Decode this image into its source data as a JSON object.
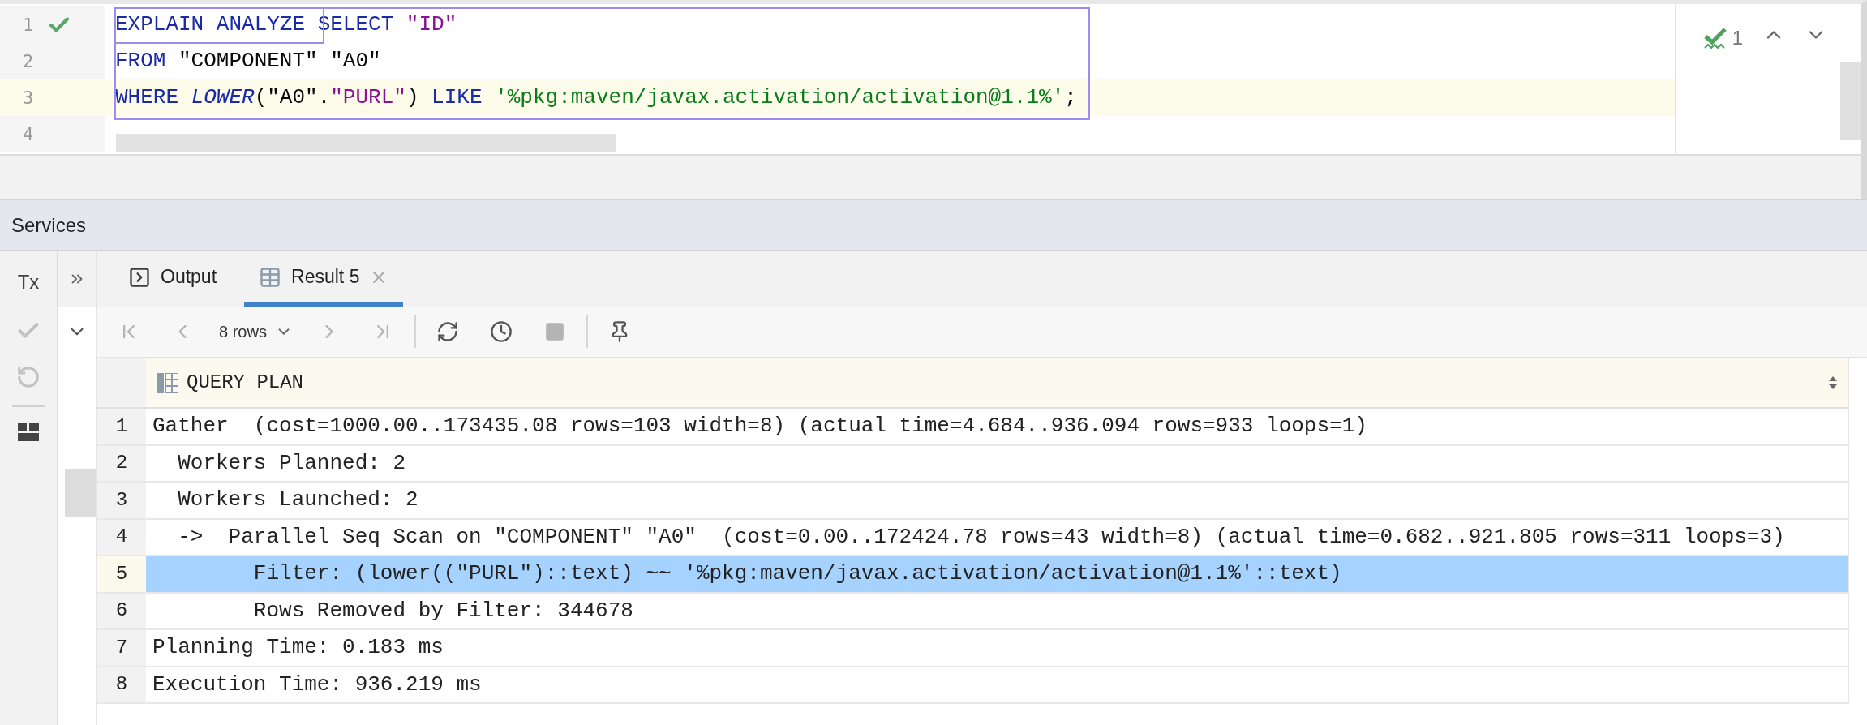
{
  "editor": {
    "lines": [
      {
        "number": "1",
        "executed": true,
        "current": false,
        "tokens": [
          {
            "kind": "keyword",
            "text": "EXPLAIN ANALYZE "
          },
          {
            "kind": "keyword",
            "text": "SELECT "
          },
          {
            "kind": "identifier",
            "text": "\"ID\""
          }
        ]
      },
      {
        "number": "2",
        "executed": false,
        "current": false,
        "tokens": [
          {
            "kind": "keyword",
            "text": "FROM "
          },
          {
            "kind": "plain",
            "text": "\"COMPONENT\" \"A0\""
          }
        ]
      },
      {
        "number": "3",
        "executed": false,
        "current": true,
        "tokens": [
          {
            "kind": "keyword",
            "text": "WHERE "
          },
          {
            "kind": "function",
            "text": "LOWER"
          },
          {
            "kind": "plain",
            "text": "(\"A0\"."
          },
          {
            "kind": "identifier",
            "text": "\"PURL\""
          },
          {
            "kind": "plain",
            "text": ") "
          },
          {
            "kind": "keyword",
            "text": "LIKE "
          },
          {
            "kind": "string",
            "text": "'%pkg:maven/javax.activation/activation@1.1%'"
          },
          {
            "kind": "plain",
            "text": ";"
          }
        ]
      },
      {
        "number": "4",
        "executed": false,
        "current": false
      }
    ],
    "inspections": {
      "count": "1"
    }
  },
  "services": {
    "title": "Services",
    "side_actions": [
      {
        "kind": "tx",
        "label": "Tx",
        "disabled": false
      },
      {
        "kind": "commit",
        "disabled": true
      },
      {
        "kind": "rollback",
        "disabled": true
      },
      {
        "kind": "layout",
        "disabled": false
      }
    ],
    "tabs": [
      {
        "kind": "console",
        "label": "Output",
        "selected": false,
        "closable": false
      },
      {
        "kind": "table",
        "label": "Result 5",
        "selected": true,
        "closable": true
      }
    ],
    "toolbar": [
      {
        "kind": "first",
        "disabled": true
      },
      {
        "kind": "prev",
        "disabled": true
      },
      {
        "kind": "page_size",
        "label": "8 rows"
      },
      {
        "kind": "next",
        "disabled": true
      },
      {
        "kind": "last",
        "disabled": true
      },
      {
        "kind": "separator"
      },
      {
        "kind": "reload",
        "disabled": false
      },
      {
        "kind": "history",
        "disabled": false
      },
      {
        "kind": "stop",
        "disabled": true
      },
      {
        "kind": "separator"
      },
      {
        "kind": "pin",
        "disabled": false
      }
    ],
    "table": {
      "column": "QUERY PLAN",
      "rows": [
        {
          "number": "1",
          "text": "Gather  (cost=1000.00..173435.08 rows=103 width=8) (actual time=4.684..936.094 rows=933 loops=1)",
          "selected": false
        },
        {
          "number": "2",
          "text": "  Workers Planned: 2",
          "selected": false
        },
        {
          "number": "3",
          "text": "  Workers Launched: 2",
          "selected": false
        },
        {
          "number": "4",
          "text": "  ->  Parallel Seq Scan on \"COMPONENT\" \"A0\"  (cost=0.00..172424.78 rows=43 width=8) (actual time=0.682..921.805 rows=311 loops=3)",
          "selected": false
        },
        {
          "number": "5",
          "text": "        Filter: (lower((\"PURL\")::text) ~~ '%pkg:maven/javax.activation/activation@1.1%'::text)",
          "selected": true
        },
        {
          "number": "6",
          "text": "        Rows Removed by Filter: 344678",
          "selected": false
        },
        {
          "number": "7",
          "text": "Planning Time: 0.183 ms",
          "selected": false
        },
        {
          "number": "8",
          "text": "Execution Time: 936.219 ms",
          "selected": false
        }
      ]
    }
  }
}
